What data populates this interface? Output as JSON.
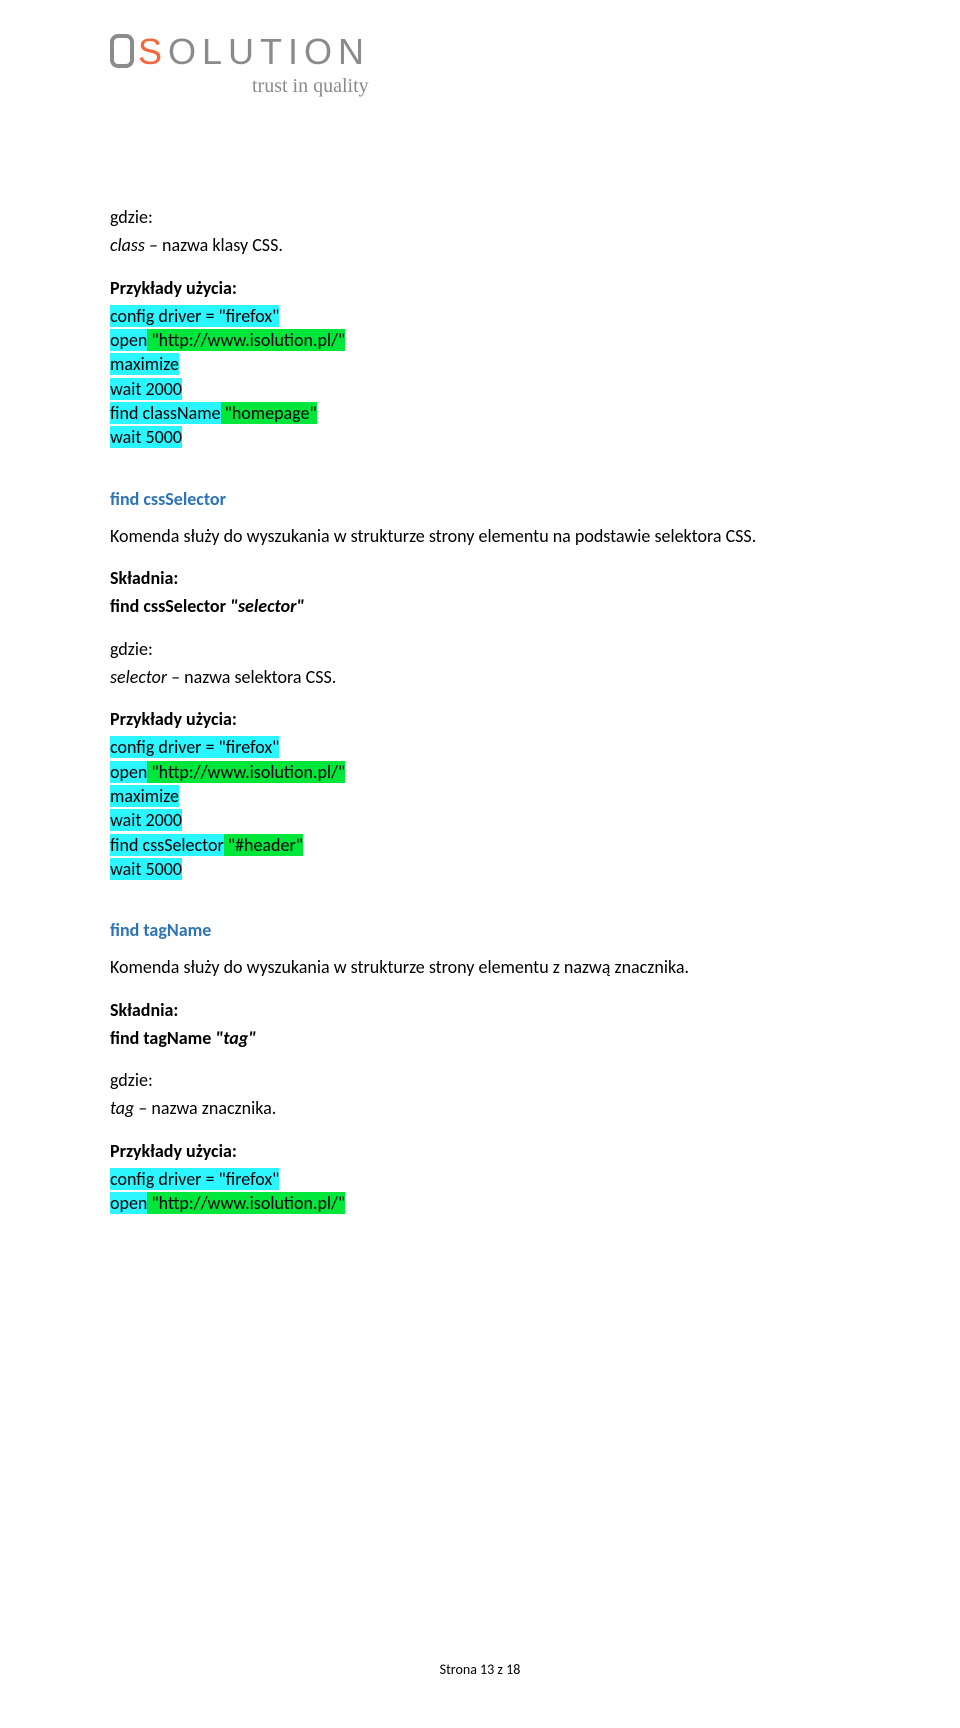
{
  "logo": {
    "name": "ISOLUTION",
    "tagline": "trust in quality"
  },
  "section1": {
    "gdzie": "gdzie:",
    "classLine_italic": "class",
    "classLine_rest": " – nazwa klasy CSS.",
    "przyklady": "Przykłady użycia:",
    "code": {
      "l1a": "config driver = \"firefox\"",
      "l2a": "open",
      "l2b": " \"http://www.isolution.pl/\"",
      "l3a": "maximize",
      "l4a": "wait 2000",
      "l5a": "find className",
      "l5b": " \"homepage\"",
      "l6a": "wait 5000"
    }
  },
  "section2": {
    "heading": "find cssSelector",
    "komenda": "Komenda służy do wyszukania w strukturze strony elementu na podstawie selektora CSS.",
    "skladnia": "Składnia:",
    "syntax_bold": "find cssSelector ",
    "syntax_bi": "\"selector\"",
    "gdzie": "gdzie:",
    "where_italic": "selector",
    "where_rest": " – nazwa selektora CSS.",
    "przyklady": "Przykłady użycia:",
    "code": {
      "l1a": "config driver = \"firefox\"",
      "l2a": "open",
      "l2b": " \"http://www.isolution.pl/\"",
      "l3a": "maximize",
      "l4a": "wait 2000",
      "l5a": "find cssSelector",
      "l5b": " \"#header\"",
      "l6a": "wait 5000"
    }
  },
  "section3": {
    "heading": "find tagName",
    "komenda": "Komenda służy do wyszukania w strukturze strony elementu z nazwą znacznika.",
    "skladnia": "Składnia:",
    "syntax_bold": "find tagName ",
    "syntax_bi": "\"tag\"",
    "gdzie": "gdzie:",
    "where_italic": "tag",
    "where_rest": " – nazwa znacznika.",
    "przyklady": "Przykłady użycia:",
    "code": {
      "l1a": "config driver = \"firefox\"",
      "l2a": "open",
      "l2b": " \"http://www.isolution.pl/\""
    }
  },
  "footer": "Strona 13 z 18"
}
